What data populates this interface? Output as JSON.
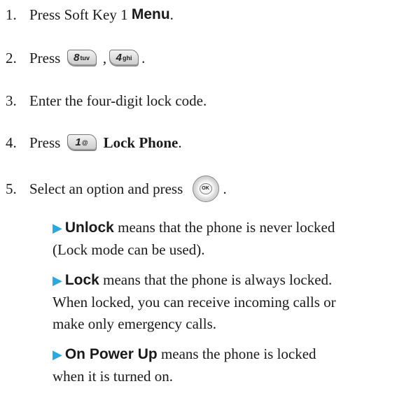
{
  "steps": [
    {
      "num": "1.",
      "pre": "Press Soft Key 1 ",
      "bold": "Menu",
      "post": "."
    },
    {
      "num": "2.",
      "pre": "Press ",
      "key1": "8",
      "key1_sub": "tuv",
      "sep": " ,",
      "key2": "4",
      "key2_sub": "ghi",
      "post": "."
    },
    {
      "num": "3.",
      "text": "Enter the four-digit lock code."
    },
    {
      "num": "4.",
      "pre": "Press ",
      "key": "1",
      "key_sub": "@",
      "bold": "Lock Phone",
      "post": "."
    },
    {
      "num": "5.",
      "pre": "Select an option and press ",
      "ok_label": "OK",
      "post": "."
    }
  ],
  "options": [
    {
      "term": "Unlock",
      "desc_line1": " means that the phone is never locked",
      "desc_line2": "(Lock mode can be used)."
    },
    {
      "term": "Lock",
      "desc_line1": " means that the phone is always locked.",
      "desc_line2": "When locked, you can receive incoming calls or",
      "desc_line3": "make only emergency calls."
    },
    {
      "term": "On Power Up",
      "desc_line1": " means the phone is locked",
      "desc_line2": "when it is turned on."
    }
  ],
  "icons": {
    "bullet": "play-arrow-icon",
    "bullet_color": "#2aa9e0"
  }
}
